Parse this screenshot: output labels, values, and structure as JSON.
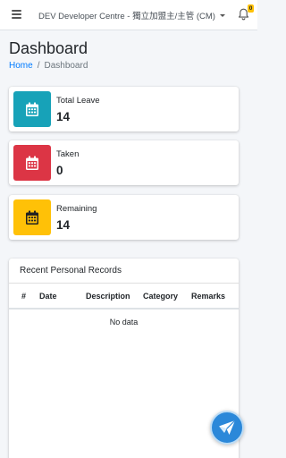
{
  "topbar": {
    "menu_icon": "hamburger-icon",
    "org_selector": "DEV Developer Centre - 獨立加盟主/主管 (CM)",
    "notification_icon": "bell-icon",
    "notification_count": "0"
  },
  "page": {
    "title": "Dashboard",
    "breadcrumb": {
      "home": "Home",
      "separator": "/",
      "current": "Dashboard"
    }
  },
  "info_boxes": [
    {
      "label": "Total Leave",
      "value": "14",
      "color": "#17a2b8",
      "icon": "calendar-icon"
    },
    {
      "label": "Taken",
      "value": "0",
      "color": "#dc3545",
      "icon": "calendar-icon"
    },
    {
      "label": "Remaining",
      "value": "14",
      "color": "#ffc107",
      "icon": "calendar-icon"
    }
  ],
  "records": {
    "title": "Recent Personal Records",
    "columns": [
      "#",
      "Date",
      "Description",
      "Category",
      "Remarks"
    ],
    "empty_text": "No data"
  },
  "fab": {
    "icon": "paper-plane-icon",
    "color": "#2b88d9"
  }
}
